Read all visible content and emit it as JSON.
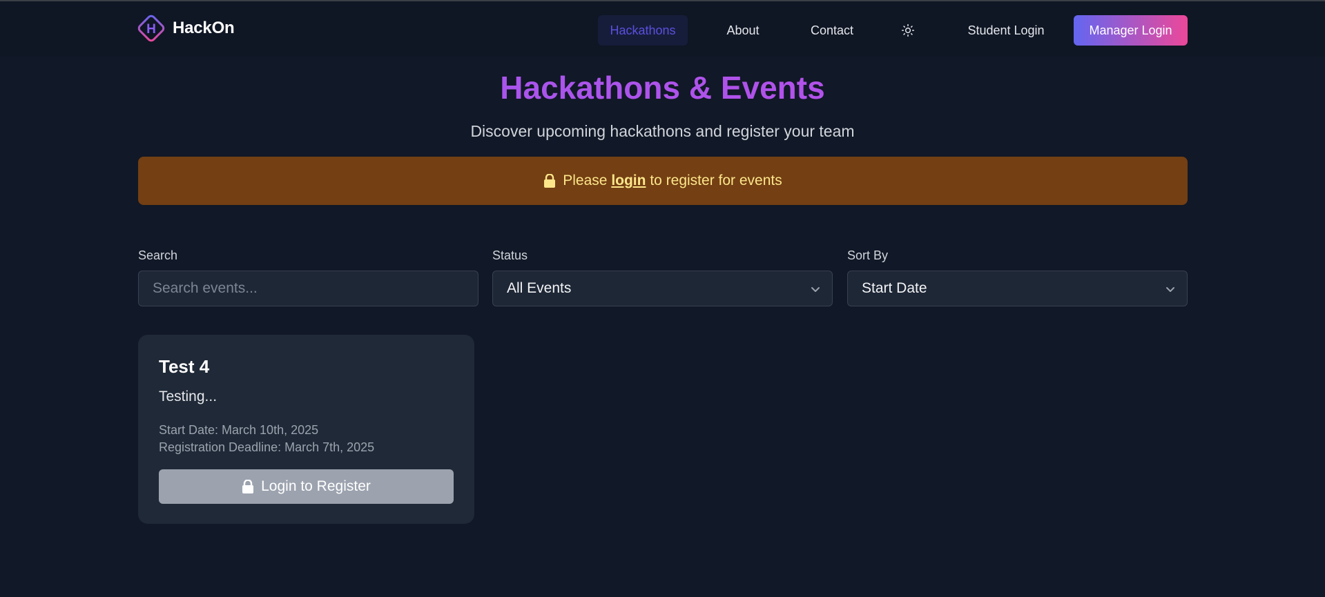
{
  "navbar": {
    "logo_letter": "H",
    "brand": "HackOn",
    "links": [
      {
        "label": "Hackathons",
        "active": true
      },
      {
        "label": "About"
      },
      {
        "label": "Contact"
      }
    ],
    "theme_icon": "sun-icon",
    "student_login": "Student Login",
    "manager_login": "Manager Login"
  },
  "colors": {
    "accent": "#6366f1",
    "accent_pink": "#ec4899",
    "title_purple": "#a855f7",
    "alert_bg": "#733f13",
    "alert_text": "#fde68a"
  },
  "header": {
    "title": "Hackathons & Events",
    "subtitle": "Discover upcoming hackathons and register your team"
  },
  "alert": {
    "icon": "lock-icon",
    "prefix": "Please",
    "link": "login",
    "suffix": "to register for events"
  },
  "filters": {
    "search": {
      "label": "Search",
      "placeholder": "Search events...",
      "value": ""
    },
    "status": {
      "label": "Status",
      "value": "All Events"
    },
    "sort": {
      "label": "Sort By",
      "value": "Start Date"
    }
  },
  "events": [
    {
      "title": "Test 4",
      "description": "Testing...",
      "start_date": "Start Date: March 10th, 2025",
      "deadline": "Registration Deadline: March 7th, 2025",
      "button": "Login to Register",
      "button_icon": "lock-icon"
    }
  ]
}
